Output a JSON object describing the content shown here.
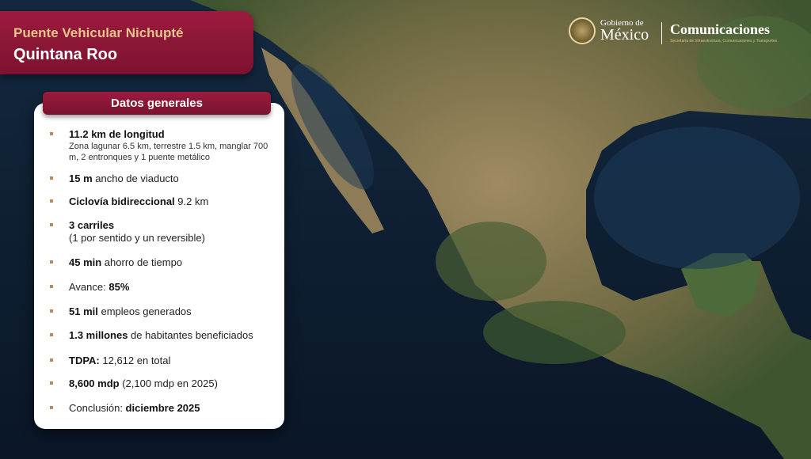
{
  "title": {
    "line1": "Puente Vehicular Nichupté",
    "line2": "Quintana Roo"
  },
  "logo": {
    "gobierno_small": "Gobierno de",
    "gobierno_big": "México",
    "comunicaciones": "Comunicaciones",
    "comunicaciones_sub": "Secretaría de Infraestructura, Comunicaciones y Transportes"
  },
  "card": {
    "header": "Datos generales",
    "items": [
      {
        "bold": "11.2 km de longitud",
        "text": "",
        "sub": "Zona lagunar 6.5 km, terrestre 1.5 km, manglar 700 m,  2 entronques y 1 puente metálico"
      },
      {
        "bold": "15 m",
        "text": " ancho de viaducto"
      },
      {
        "bold": "Ciclovía bidireccional",
        "text": " 9.2 km"
      },
      {
        "bold": "3 carriles",
        "text": "",
        "sub2": "(1 por sentido y un reversible)"
      },
      {
        "bold": "45 min",
        "text": " ahorro de tiempo"
      },
      {
        "prefix": "Avance: ",
        "bold": "85%"
      },
      {
        "bold": "51 mil",
        "text": " empleos generados"
      },
      {
        "bold": "1.3 millones",
        "text": " de habitantes beneficiados"
      },
      {
        "bold": "TDPA:",
        "text": " 12,612 en total"
      },
      {
        "bold": "8,600 mdp",
        "text": " (2,100 mdp en 2025)"
      },
      {
        "prefix": "Conclusión: ",
        "bold": "diciembre 2025"
      }
    ]
  },
  "colors": {
    "brand_red": "#9b1b3d",
    "gold": "#b38e5d",
    "ocean": "#0b1a2e"
  }
}
